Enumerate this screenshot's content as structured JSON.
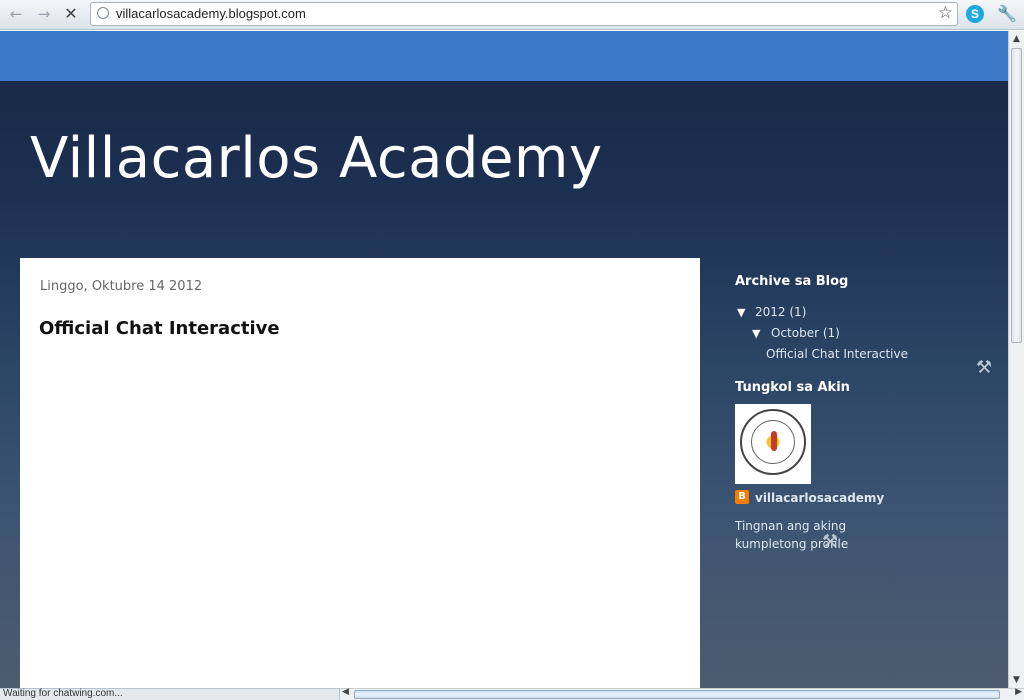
{
  "browser": {
    "back_icon": "back-arrow-icon",
    "forward_icon": "forward-arrow-icon",
    "stop_icon": "stop-icon",
    "url": "villacarlosacademy.blogspot.com",
    "status_text": "Waiting for chatwing.com..."
  },
  "blog": {
    "title": "Villacarlos Academy",
    "post": {
      "date": "Linggo, Oktubre 14 2012",
      "title": "Official Chat Interactive"
    },
    "sidebar": {
      "archive_heading": "Archive sa Blog",
      "archive_year": "2012",
      "archive_year_count": "(1)",
      "archive_month": "October",
      "archive_month_count": "(1)",
      "archive_post": "Official Chat Interactive",
      "about_heading": "Tungkol sa Akin",
      "profile_name": "villacarlosacademy",
      "profile_link": "Tingnan ang aking kumpletong profile"
    }
  },
  "colors": {
    "header_band": "#3a79c8",
    "background_top": "#172742",
    "blogger_orange": "#f57d00"
  }
}
